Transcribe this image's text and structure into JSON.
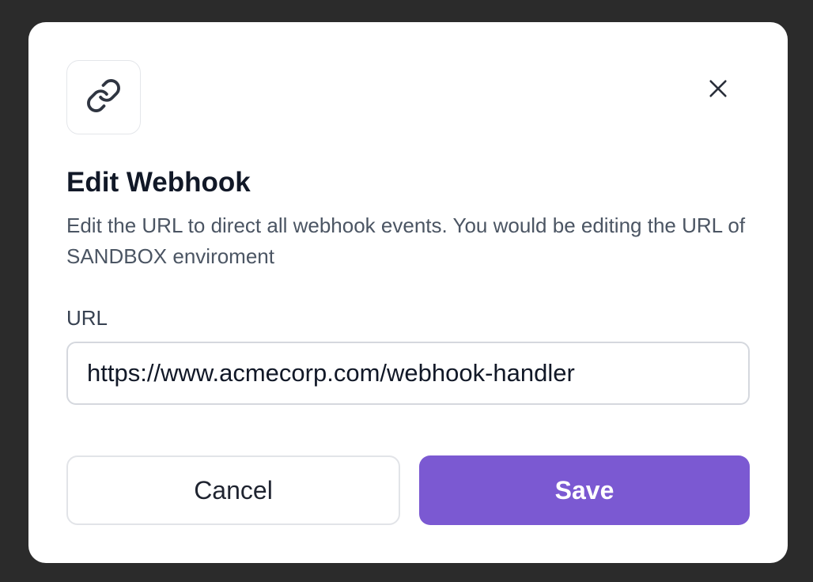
{
  "modal": {
    "icon": "link-icon",
    "close_icon": "close-icon",
    "title": "Edit Webhook",
    "description": "Edit the URL to direct all webhook events. You would be editing the URL of SANDBOX enviroment",
    "url_label": "URL",
    "url_value": "https://www.acmecorp.com/webhook-handler",
    "cancel_label": "Cancel",
    "save_label": "Save"
  },
  "colors": {
    "backdrop": "#2b2b2b",
    "primary": "#7b59d2",
    "title": "#111827",
    "muted_text": "#4b5563",
    "border": "#d5d8de"
  }
}
